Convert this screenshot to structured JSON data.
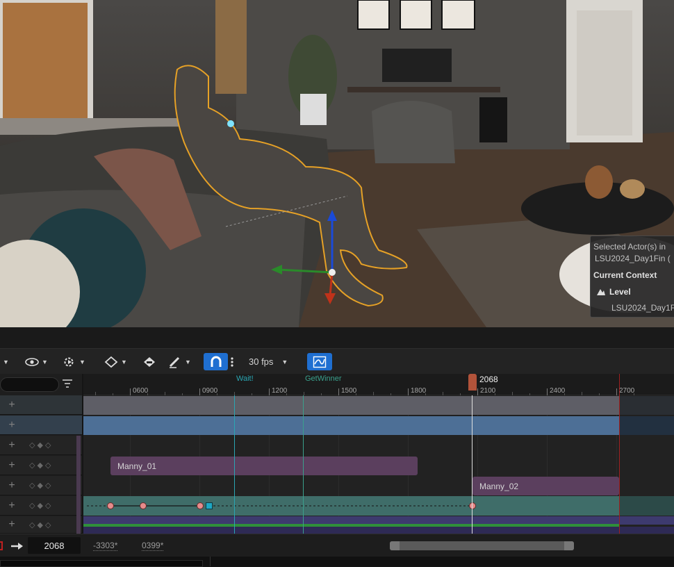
{
  "viewport": {
    "context_panel": {
      "selected_text": "Selected Actor(s) in",
      "level_name_line": "LSU2024_Day1Fin (",
      "heading": "Current Context",
      "level_label": "Level",
      "level_value": "LSU2024_Day1F"
    }
  },
  "toolbar": {
    "fps": "30 fps"
  },
  "timeline": {
    "current_frame": "2068",
    "markers": [
      {
        "label": "Wait!"
      },
      {
        "label": "GetWinner"
      }
    ],
    "ruler_ticks": [
      {
        "label": "0600",
        "value": 600
      },
      {
        "label": "0900",
        "value": 900
      },
      {
        "label": "1200",
        "value": 1200
      },
      {
        "label": "1500",
        "value": 1500
      },
      {
        "label": "1800",
        "value": 1800
      },
      {
        "label": "2100",
        "value": 2100
      },
      {
        "label": "2400",
        "value": 2400
      },
      {
        "label": "2700",
        "value": 2700
      }
    ],
    "sections": [
      {
        "label": "Manny_01"
      },
      {
        "label": "Manny_02"
      }
    ]
  },
  "bottom": {
    "frame_value": "2068",
    "start": "-3303*",
    "end": "0399*"
  },
  "colors": {
    "accent_blue": "#1f6fd1",
    "playhead": "#b2533a",
    "section": "#5b3f5e",
    "cam_track": "#4a8a86",
    "marker_green": "#3aa08c"
  }
}
